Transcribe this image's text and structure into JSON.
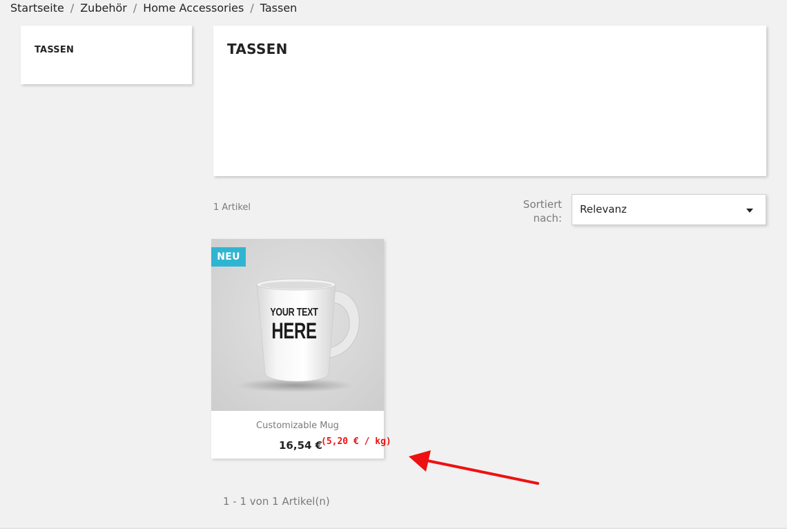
{
  "breadcrumb": {
    "items": [
      "Startseite",
      "Zubehör",
      "Home Accessories",
      "Tassen"
    ],
    "separator": "/"
  },
  "sidebar": {
    "category_title": "TASSEN"
  },
  "category_header": {
    "title": "TASSEN"
  },
  "listing": {
    "product_count": "1 Artikel",
    "sort_label": "Sortiert nach:",
    "sort_value": "Relevanz",
    "pagination_summary": "1 - 1 von 1 Artikel(n)"
  },
  "product": {
    "badge": "NEU",
    "mug_text_line1": "YOUR TEXT",
    "mug_text_line2": "HERE",
    "name": "Customizable Mug",
    "price": "16,54 €",
    "unit_price": "(5,20 € / kg)"
  },
  "colors": {
    "background": "#f1f1f1",
    "badge": "#2fb5d2",
    "annotation": "#ee1111"
  }
}
